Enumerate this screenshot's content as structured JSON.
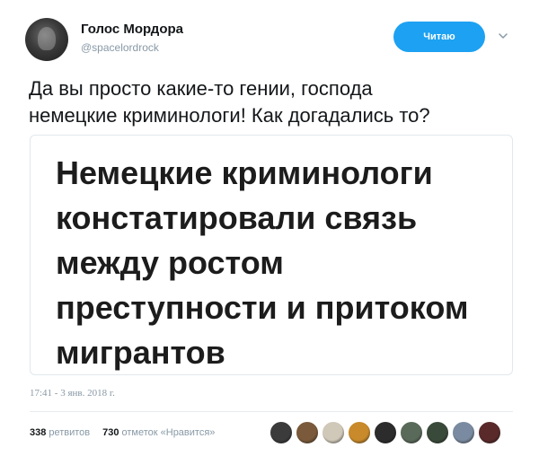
{
  "user": {
    "name": "Голос Мордора",
    "handle": "@spacelordrock"
  },
  "follow_button": {
    "label": "Читаю"
  },
  "tweet": {
    "text_lines": [
      "Да вы просто какие-то гении, господа",
      "немецкие криминологи! Как догадались то?"
    ]
  },
  "media": {
    "headline_lines": [
      "Немецкие криминологи",
      "констатировали связь",
      "между ростом",
      "преступности и притоком",
      "мигрантов"
    ]
  },
  "timestamp": "17:41 - 3 янв. 2018 г.",
  "stats": {
    "retweets_count": "338",
    "retweets_label": "ретвитов",
    "likes_count": "730",
    "likes_label": "отметок «Нравится»"
  },
  "likers": {
    "colors": [
      "#3b3b3b",
      "#7a5a3a",
      "#d0c8b8",
      "#c88a2a",
      "#2c2c2c",
      "#5a6a5a",
      "#3a4a3a",
      "#7a8aa0",
      "#5a2a2a"
    ]
  },
  "colors": {
    "accent": "#1da1f2",
    "muted": "#8899a6"
  }
}
